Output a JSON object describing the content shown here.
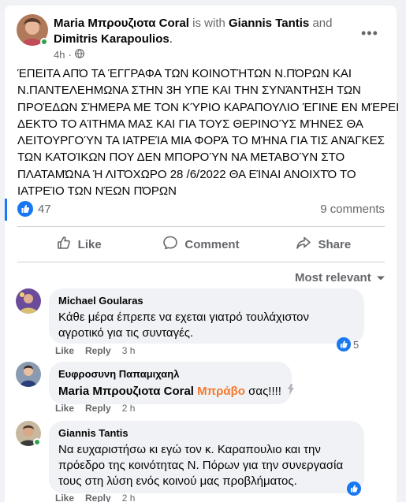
{
  "post": {
    "author": "Maria Μπρουζιοτα Coral",
    "with_text": "is with",
    "tagged1": "Giannis Tantis",
    "and_text": "and",
    "tagged2": "Dimitris Karapoulios",
    "tagged2_suffix": ".",
    "time": "4h",
    "dot": "·",
    "privacy_icon": "globe-icon",
    "more_label": "•••",
    "body_lines": [
      "ΈΠΕΙΤΑ ΑΠΌ ΤΑ ΈΓΓΡΑΦΑ ΤΩΝ ΚΟΙΝΟΤΉΤΩΝ Ν.ΠΌΡΩΝ ΚΑΙ",
      "Ν.ΠΑΝΤΕΛΕΗΜΩΝΑ ΣΤΗΝ 3Η ΥΠΕ ΚΑΙ ΤΗΝ ΣΥΝΆΝΤΗΣΗ ΤΩΝ",
      "ΠΡΟΈΔΩΝ ΣΉΜΕΡΑ ΜΕ ΤΟΝ ΚΎΡΙΟ ΚΑΡΑΠΟΥΛΙΟ ΈΓΙΝΕ ΕΝ ΜΈΡΕΙ",
      "ΔΕΚΤΌ ΤΟ ΑΊΤΗΜΑ ΜΑΣ ΚΑΙ ΓΙΑ ΤΟΥΣ ΘΕΡΙΝΟΎΣ ΜΉΝΕΣ ΘΑ",
      "ΛΕΙΤΟΥΡΓΟΎΝ ΤΑ ΙΑΤΡΕΊΑ ΜΙΑ ΦΟΡΆ ΤΟ ΜΉΝΑ ΓΙΑ ΤΙΣ ΑΝΆΓΚΕΣ",
      "ΤΩΝ ΚΑΤΟΊΚΩΝ ΠΟΥ ΔΕΝ ΜΠΟΡΟΎΝ ΝΑ ΜΕΤΑΒΟΎΝ ΣΤΟ",
      "ΠΛΑΤΑΜΏΝΑ Ή ΛΙΤΌΧΩΡΟ 28 /6/2022 ΘΑ ΕΊΝΑΙ ΑΝΟΙΧΤΌ ΤΟ",
      "ΙΑΤΡΕΊΟ ΤΩΝ ΝΈΩΝ ΠΌΡΩΝ"
    ],
    "reactions_count": "47",
    "comments_count": "9 comments"
  },
  "actions": {
    "like": "Like",
    "comment": "Comment",
    "share": "Share"
  },
  "sort_label": "Most relevant",
  "comments": [
    {
      "author": "Michael Goularas",
      "lines": [
        "Κάθε μέρα έπρεπε να εχεται γιατρό τουλάχιστον",
        "αγροτικό για τις συνταγές."
      ],
      "like": "Like",
      "reply": "Reply",
      "time": "3 h",
      "reactions": "5"
    },
    {
      "author": "Ευφροσυνη Παπαμιχαηλ",
      "tag": "Maria Μπρουζιοτα Coral",
      "highlight": "Μπράβο",
      "rest": "σας!!!!",
      "like": "Like",
      "reply": "Reply",
      "time": "2 h"
    },
    {
      "author": "Giannis Tantis",
      "lines": [
        "Να ευχαριστήσω κι εγώ τον κ. Καραπουλιο και την",
        "πρόεδρο της κοινότητας Ν. Πόρων για την συνεργασία",
        "τους στη λύση ενός κοινού μας προβλήματος."
      ],
      "like": "Like",
      "reply": "Reply",
      "time": "2 h"
    }
  ],
  "colors": {
    "accent": "#1877f2",
    "online": "#31a24c",
    "highlight": "#f5792d"
  }
}
